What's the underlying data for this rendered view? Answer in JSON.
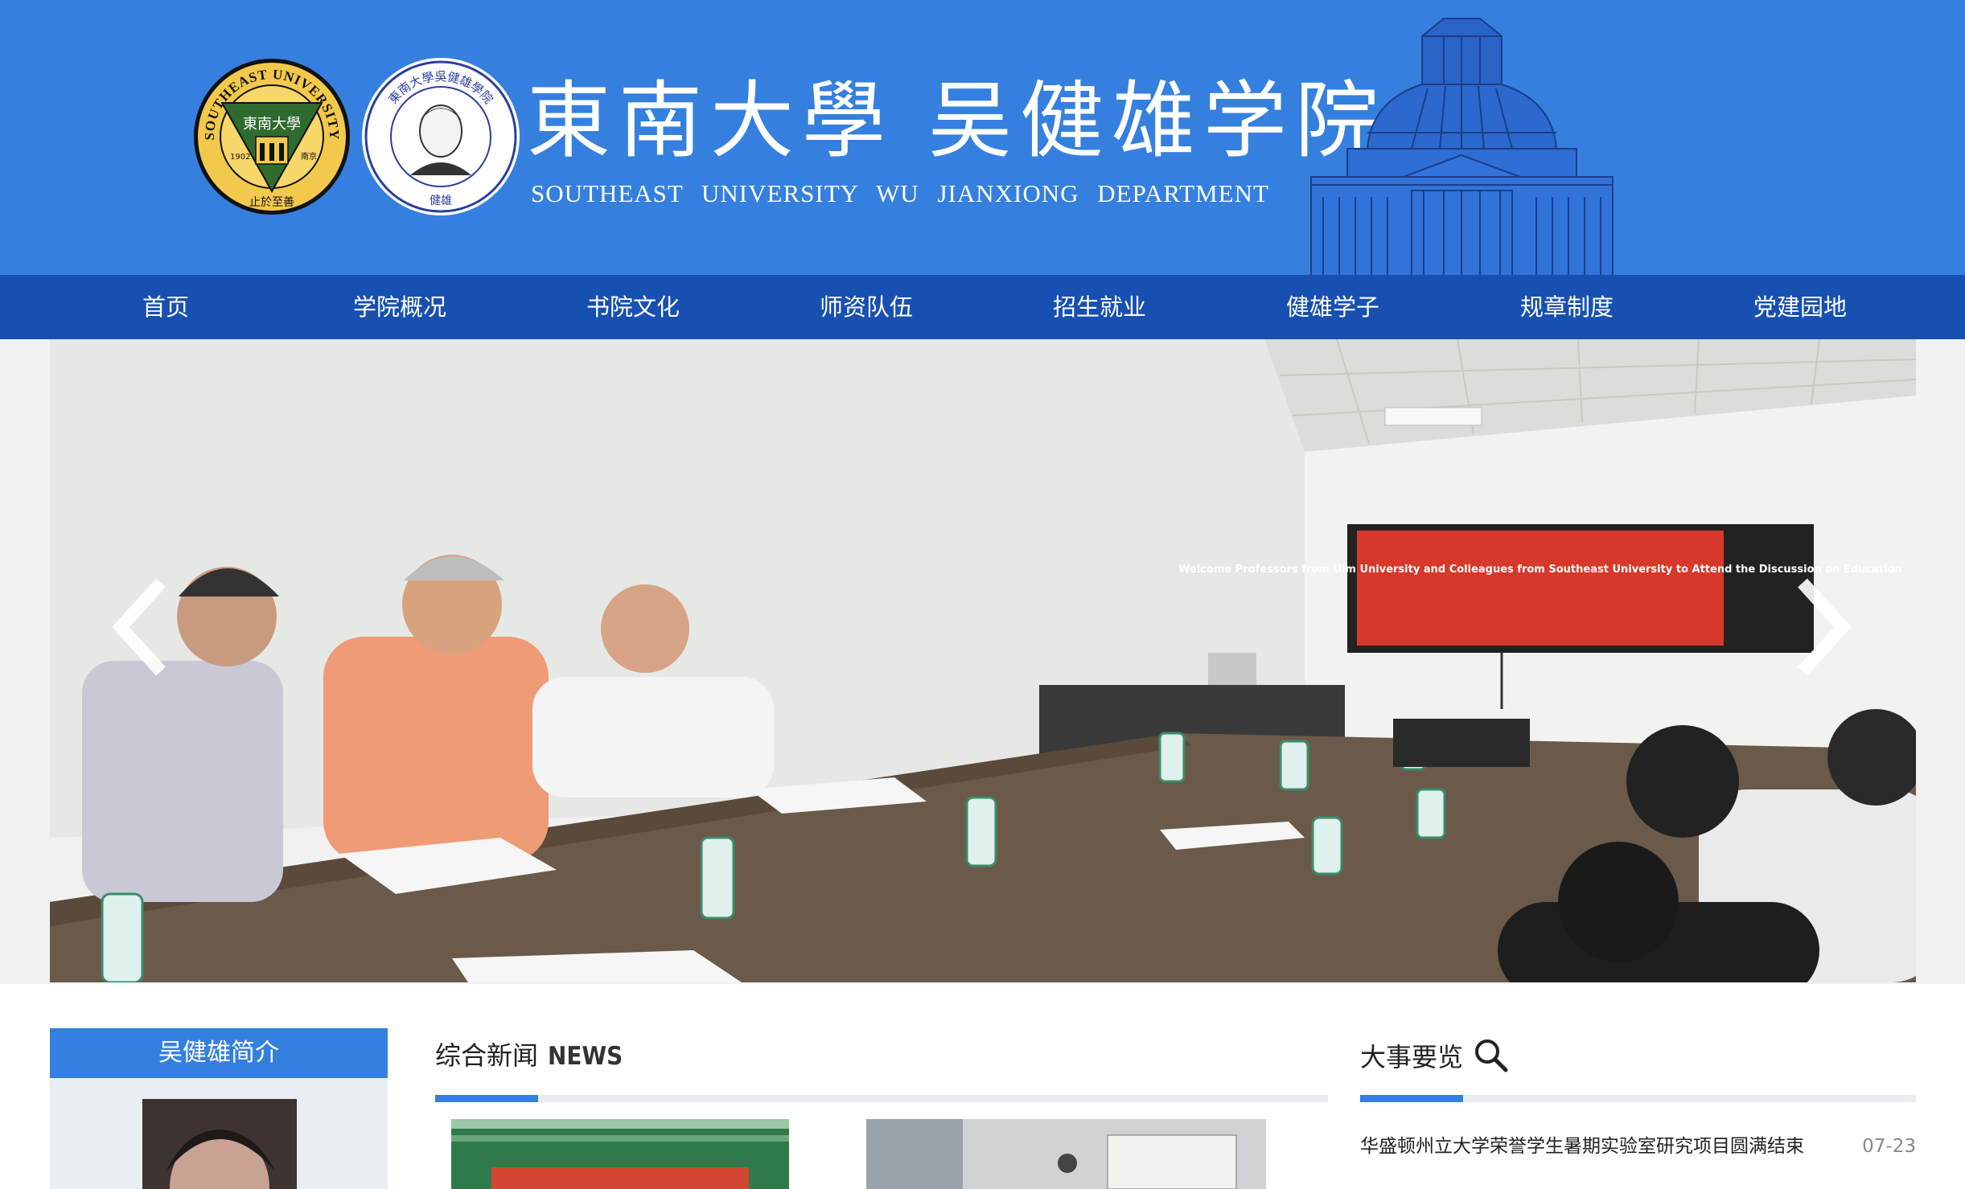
{
  "header": {
    "brand_cn": "東南大學 吴健雄学院",
    "brand_en": "SOUTHEAST UNIVERSITY  WU JIANXIONG  DEPARTMENT",
    "seu_logo": {
      "ring_text": "SOUTHEAST UNIVERSITY",
      "center_text": "東南大學",
      "year": "1902",
      "city": "南京",
      "motto": "止於至善"
    },
    "wjx_logo": {
      "ring_text": "東南大學吳健雄學院",
      "bottom_text": "健雄"
    }
  },
  "nav": {
    "items": [
      {
        "label": "首页"
      },
      {
        "label": "学院概况"
      },
      {
        "label": "书院文化"
      },
      {
        "label": "师资队伍"
      },
      {
        "label": "招生就业"
      },
      {
        "label": "健雄学子"
      },
      {
        "label": "规章制度"
      },
      {
        "label": "党建园地"
      }
    ]
  },
  "slider": {
    "screen_text": "Welcome Professors from Ulm University and Colleagues from Southeast University to Attend the Discussion on Education",
    "prev_icon": "chevron-left-icon",
    "next_icon": "chevron-right-icon"
  },
  "intro": {
    "title": "吴健雄简介"
  },
  "news": {
    "title": "综合新闻",
    "title_en": "NEWS"
  },
  "events": {
    "title": "大事要览",
    "icon": "search-icon",
    "items": [
      {
        "title": "华盛顿州立大学荣誉学生暑期实验室研究项目圆满结束",
        "date": "07-23"
      }
    ]
  },
  "colors": {
    "header_bg": "#3580df",
    "nav_bg": "#1750b1",
    "accent": "#3580df"
  }
}
